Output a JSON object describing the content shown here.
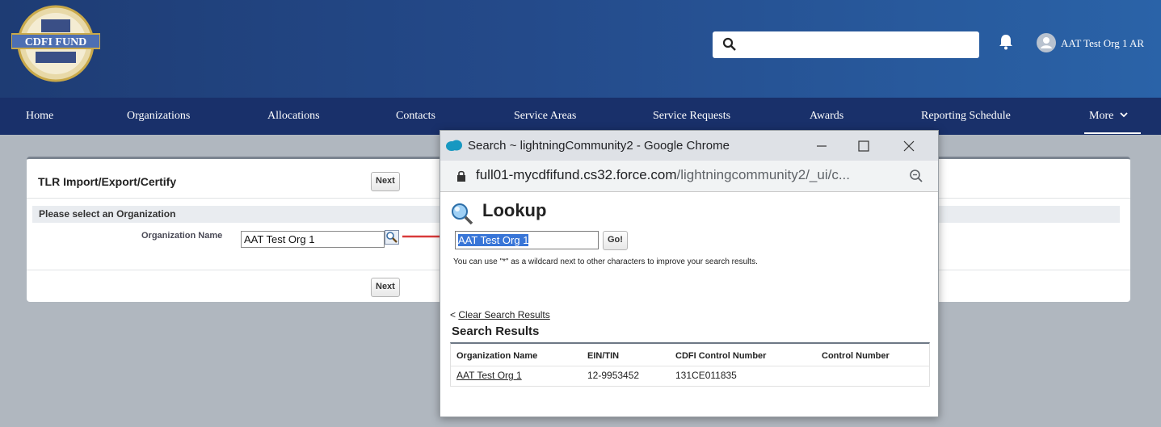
{
  "header": {
    "logo_text": "CDFI FUND",
    "search_placeholder": "",
    "user_name": "AAT Test Org 1 AR"
  },
  "nav": {
    "items": [
      "Home",
      "Organizations",
      "Allocations",
      "Contacts",
      "Service Areas",
      "Service Requests",
      "Awards",
      "Reporting Schedule",
      "More"
    ]
  },
  "panel": {
    "title": "TLR Import/Export/Certify",
    "next_label": "Next",
    "section_title": "Please select an Organization",
    "field_label": "Organization Name",
    "field_value": "AAT Test Org 1"
  },
  "popup": {
    "window_title": "Search ~ lightningCommunity2 - Google Chrome",
    "url_host": "full01-mycdfifund.cs32.force.com",
    "url_path": "/lightningcommunity2/_ui/c...",
    "lookup_title": "Lookup",
    "search_value": "AAT Test Org 1",
    "go_label": "Go!",
    "hint": "You can use \"*\" as a wildcard next to other characters to improve your search results.",
    "clear_prefix": "< ",
    "clear_link": "Clear Search Results",
    "results_title": "Search Results",
    "columns": [
      "Organization Name",
      "EIN/TIN",
      "CDFI Control Number",
      "Control Number"
    ],
    "rows": [
      {
        "org": "AAT Test Org 1",
        "ein": "12-9953452",
        "cdfi": "131CE011835",
        "control": ""
      }
    ]
  }
}
